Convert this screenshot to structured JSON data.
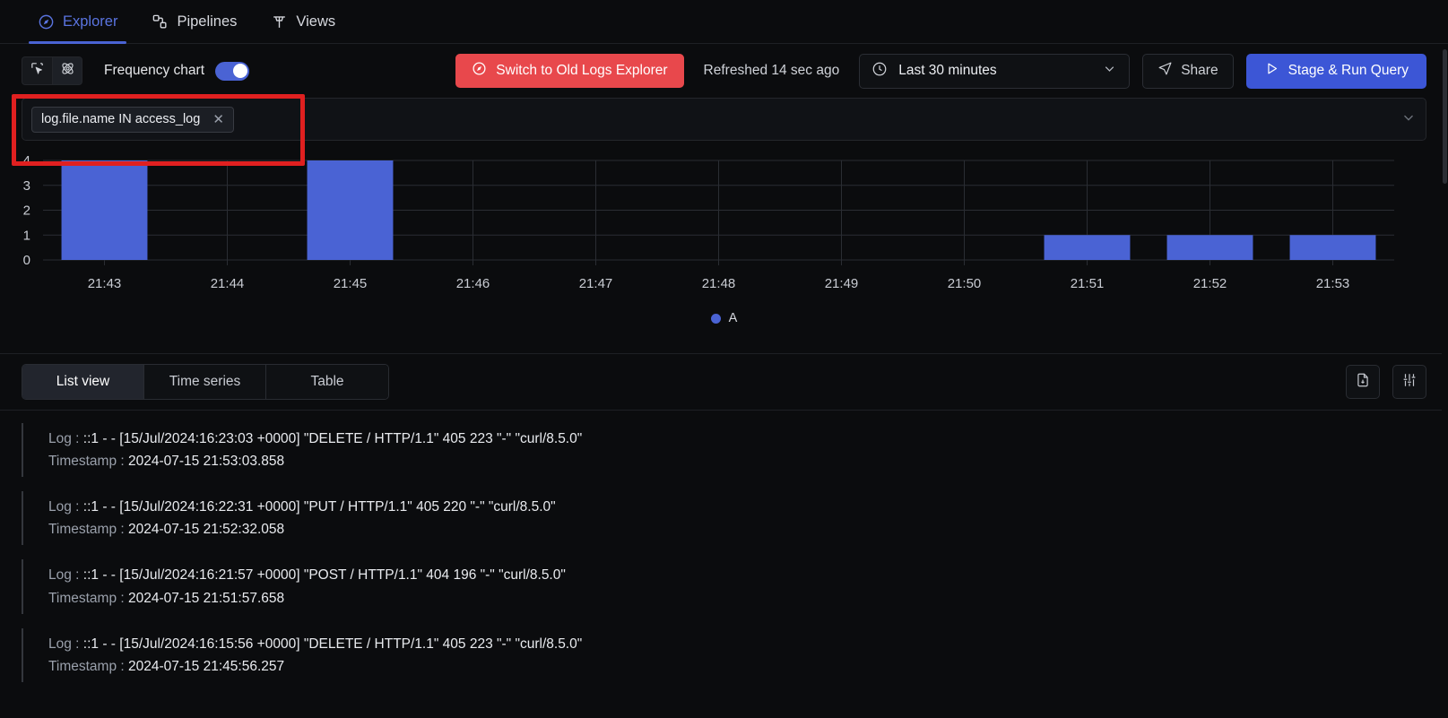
{
  "nav": {
    "tabs": [
      {
        "label": "Explorer",
        "icon": "compass-icon",
        "active": true
      },
      {
        "label": "Pipelines",
        "icon": "pipelines-icon",
        "active": false
      },
      {
        "label": "Views",
        "icon": "views-icon",
        "active": false
      }
    ]
  },
  "toolbar": {
    "select_icon": "cursor-select-icon",
    "atom_icon": "atom-icon",
    "frequency_chart_label": "Frequency chart",
    "frequency_chart_on": true,
    "switch_old_explorer_label": "Switch to Old Logs Explorer",
    "switch_old_explorer_icon": "compass-icon",
    "refreshed_label": "Refreshed 14 sec ago",
    "time_range_value": "Last 30 minutes",
    "time_range_icon": "clock-icon",
    "time_range_chevron": "chevron-down-icon",
    "share_label": "Share",
    "share_icon": "send-icon",
    "run_query_label": "Stage & Run Query",
    "run_query_icon": "play-icon"
  },
  "filter": {
    "chip_label": "log.file.name IN access_log",
    "chip_remove_icon": "close-icon",
    "expand_icon": "chevron-down-icon"
  },
  "chart_data": {
    "type": "bar",
    "title": "",
    "xlabel": "",
    "ylabel": "",
    "categories": [
      "21:43",
      "21:44",
      "21:45",
      "21:46",
      "21:47",
      "21:48",
      "21:49",
      "21:50",
      "21:51",
      "21:52",
      "21:53"
    ],
    "values": [
      4,
      0,
      4,
      0,
      0,
      0,
      0,
      0,
      1,
      1,
      1
    ],
    "ytick_labels": [
      "0",
      "1",
      "2",
      "3",
      "4"
    ],
    "ylim": [
      0,
      4
    ],
    "grid": true,
    "bar_color": "#4a63d4",
    "legend": {
      "position": "bottom",
      "entries": [
        "A"
      ]
    }
  },
  "views": {
    "tabs": [
      {
        "label": "List view",
        "active": true
      },
      {
        "label": "Time series",
        "active": false
      },
      {
        "label": "Table",
        "active": false
      }
    ],
    "download_icon": "file-download-icon",
    "options_icon": "sliders-icon"
  },
  "logs": {
    "log_key": "Log :",
    "timestamp_key": "Timestamp :",
    "entries": [
      {
        "log": "::1 - - [15/Jul/2024:16:23:03 +0000] \"DELETE / HTTP/1.1\" 405 223 \"-\" \"curl/8.5.0\"",
        "timestamp": "2024-07-15 21:53:03.858"
      },
      {
        "log": "::1 - - [15/Jul/2024:16:22:31 +0000] \"PUT / HTTP/1.1\" 405 220 \"-\" \"curl/8.5.0\"",
        "timestamp": "2024-07-15 21:52:32.058"
      },
      {
        "log": "::1 - - [15/Jul/2024:16:21:57 +0000] \"POST / HTTP/1.1\" 404 196 \"-\" \"curl/8.5.0\"",
        "timestamp": "2024-07-15 21:51:57.658"
      },
      {
        "log": "::1 - - [15/Jul/2024:16:15:56 +0000] \"DELETE / HTTP/1.1\" 405 223 \"-\" \"curl/8.5.0\"",
        "timestamp": "2024-07-15 21:45:56.257"
      }
    ]
  },
  "annotation": {
    "highlight_color": "#e02020"
  },
  "colors": {
    "accent": "#4a63d4",
    "danger": "#e8484c",
    "background": "#0b0c0e"
  }
}
